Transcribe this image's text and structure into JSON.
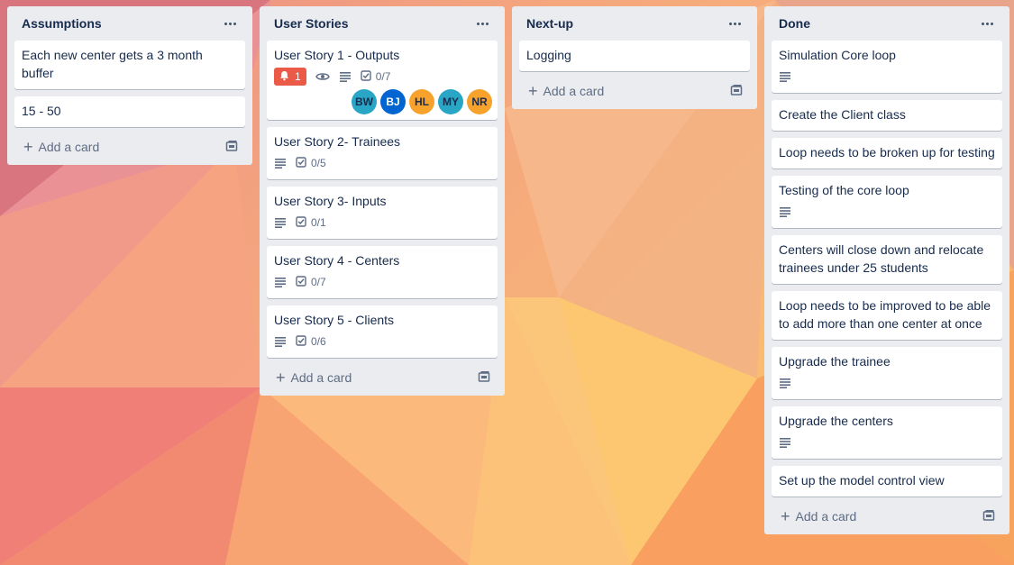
{
  "lists": [
    {
      "title": "Assumptions",
      "add_label": "Add a card",
      "cards": [
        {
          "title": "Each new center gets a 3 month buffer"
        },
        {
          "title": "15 - 50"
        }
      ]
    },
    {
      "title": "User Stories",
      "add_label": "Add a card",
      "cards": [
        {
          "title": "User Story 1 - Outputs",
          "alert_count": "1",
          "checklist": "0/7",
          "members": [
            {
              "initials": "BW",
              "color": "#29a6c6"
            },
            {
              "initials": "BJ",
              "color": "#0065d1"
            },
            {
              "initials": "HL",
              "color": "#f6a22d"
            },
            {
              "initials": "MY",
              "color": "#29a6c6"
            },
            {
              "initials": "NR",
              "color": "#f6a22d"
            }
          ]
        },
        {
          "title": "User Story 2- Trainees",
          "checklist": "0/5"
        },
        {
          "title": "User Story 3- Inputs",
          "checklist": "0/1"
        },
        {
          "title": "User Story 4 - Centers",
          "checklist": "0/7"
        },
        {
          "title": "User Story 5 - Clients",
          "checklist": "0/6"
        }
      ]
    },
    {
      "title": "Next-up",
      "add_label": "Add a card",
      "cards": [
        {
          "title": "Logging"
        }
      ]
    },
    {
      "title": "Done",
      "add_label": "Add a card",
      "cards": [
        {
          "title": "Simulation Core loop"
        },
        {
          "title": "Create the Client class"
        },
        {
          "title": "Loop needs to be broken up for testing"
        },
        {
          "title": "Testing of the core loop"
        },
        {
          "title": "Centers will close down and relocate trainees under 25 students"
        },
        {
          "title": "Loop needs to be improved to be able to add more than one center at once"
        },
        {
          "title": "Upgrade the trainee"
        },
        {
          "title": "Upgrade the centers"
        },
        {
          "title": "Set up the model control view"
        }
      ]
    }
  ]
}
